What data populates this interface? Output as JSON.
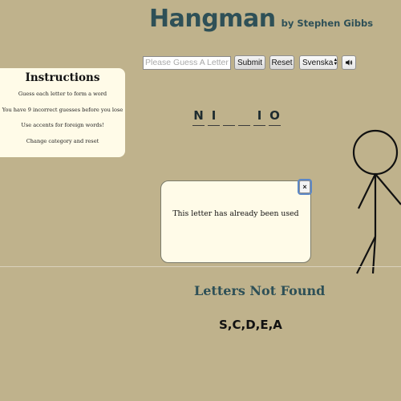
{
  "header": {
    "title": "Hangman",
    "byline": "by Stephen Gibbs"
  },
  "controls": {
    "guess_placeholder": "Please Guess A Letter",
    "guess_value": "",
    "submit_label": "Submit",
    "reset_label": "Reset",
    "language_selected": "Svenska",
    "sound_icon": "speaker-icon"
  },
  "instructions": {
    "title": "Instructions",
    "lines": [
      "Guess each letter to form a word",
      "You have 9 incorrect guesses before you lose",
      "Use accents for foreign words!",
      "Change category and reset"
    ]
  },
  "word": {
    "slots": [
      "N",
      "I",
      "",
      "",
      "I",
      "O"
    ]
  },
  "modal": {
    "message": "This letter has already been used",
    "close_label": "×"
  },
  "letters_not_found": {
    "title": "Letters Not Found",
    "letters": "S,C,D,E,A"
  },
  "colors": {
    "background": "#bfb28c",
    "accent": "#2e5057",
    "panel": "#fffbe8"
  }
}
